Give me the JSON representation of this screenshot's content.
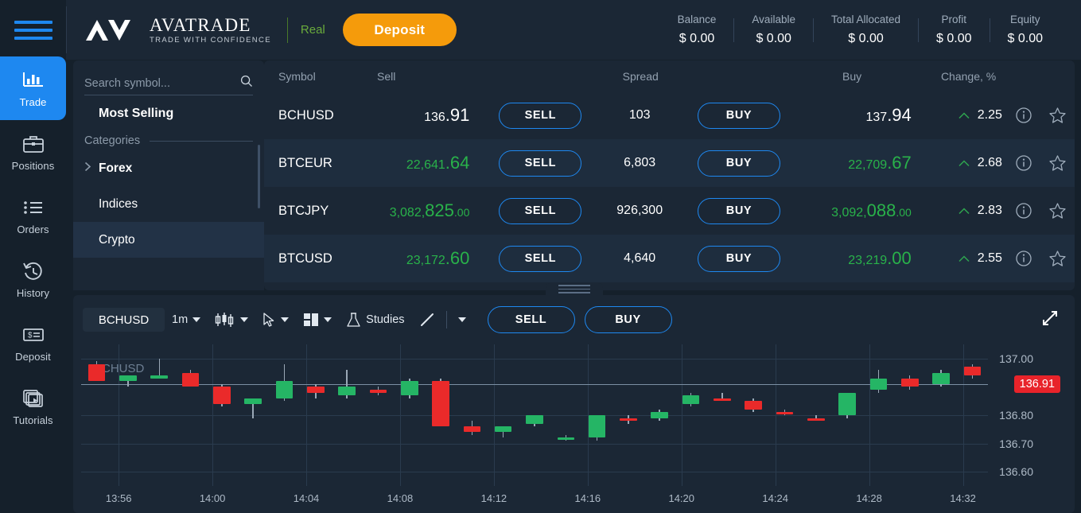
{
  "brand": {
    "logo_line1": "AVATRADE",
    "logo_line2": "TRADE WITH CONFIDENCE",
    "account_mode": "Real",
    "deposit_label": "Deposit",
    "accent_blue": "#1e88f0",
    "accent_orange": "#f59b0b",
    "accent_green": "#29b24a",
    "accent_red": "#e8232a"
  },
  "header_stats": [
    {
      "label": "Balance",
      "value": "$ 0.00"
    },
    {
      "label": "Available",
      "value": "$ 0.00"
    },
    {
      "label": "Total Allocated",
      "value": "$ 0.00"
    },
    {
      "label": "Profit",
      "value": "$ 0.00"
    },
    {
      "label": "Equity",
      "value": "$ 0.00"
    }
  ],
  "sidebar": {
    "items": [
      {
        "label": "Trade",
        "icon": "bar-chart-icon",
        "active": true
      },
      {
        "label": "Positions",
        "icon": "briefcase-icon",
        "active": false
      },
      {
        "label": "Orders",
        "icon": "list-icon",
        "active": false
      },
      {
        "label": "History",
        "icon": "clock-rewind-icon",
        "active": false
      },
      {
        "label": "Deposit",
        "icon": "cheque-icon",
        "active": false
      },
      {
        "label": "Tutorials",
        "icon": "video-stack-icon",
        "active": false
      }
    ]
  },
  "search_panel": {
    "placeholder": "Search symbol...",
    "value": "",
    "most_selling": "Most Selling",
    "categories_label": "Categories",
    "categories": [
      {
        "label": "Forex",
        "expandable": true,
        "selected": false
      },
      {
        "label": "Indices",
        "expandable": false,
        "selected": false
      },
      {
        "label": "Crypto",
        "expandable": false,
        "selected": true
      }
    ]
  },
  "quotes": {
    "columns": [
      "Symbol",
      "Sell",
      "Spread",
      "Buy",
      "Change, %"
    ],
    "sell_label": "SELL",
    "buy_label": "BUY",
    "rows": [
      {
        "symbol": "BCHUSD",
        "sell": {
          "pre": "136",
          "big": ".91",
          "post": "",
          "color": "white"
        },
        "spread": "103",
        "buy": {
          "pre": "137",
          "big": ".94",
          "post": "",
          "color": "white"
        },
        "change": "2.25",
        "direction": "up"
      },
      {
        "symbol": "BTCEUR",
        "sell": {
          "pre": "22,641",
          "big": ".64",
          "post": "",
          "color": "green"
        },
        "spread": "6,803",
        "buy": {
          "pre": "22,709",
          "big": ".67",
          "post": "",
          "color": "green"
        },
        "change": "2.68",
        "direction": "up"
      },
      {
        "symbol": "BTCJPY",
        "sell": {
          "pre": "3,082,",
          "big": "825",
          "post": ".00",
          "color": "green"
        },
        "spread": "926,300",
        "buy": {
          "pre": "3,092,",
          "big": "088",
          "post": ".00",
          "color": "green"
        },
        "change": "2.83",
        "direction": "up"
      },
      {
        "symbol": "BTCUSD",
        "sell": {
          "pre": "23,172",
          "big": ".60",
          "post": "",
          "color": "green"
        },
        "spread": "4,640",
        "buy": {
          "pre": "23,219",
          "big": ".00",
          "post": "",
          "color": "green"
        },
        "change": "2.55",
        "direction": "up"
      }
    ]
  },
  "chart_toolbar": {
    "symbol": "BCHUSD",
    "timeframe": "1m",
    "chart_type_icon": "candlestick-icon",
    "cursor_icon": "cursor-arrow-icon",
    "layout_icon": "layout-panels-icon",
    "studies_label": "Studies",
    "studies_icon": "flask-icon",
    "drawing_icon": "trend-line-icon",
    "sell_label": "SELL",
    "buy_label": "BUY",
    "expand_icon": "expand-arrows-icon"
  },
  "chart_data": {
    "type": "candlestick",
    "title": "BCHUSD",
    "watermark": "BCHUSD",
    "timeframe": "1m",
    "xlabel": "",
    "ylabel": "",
    "ylim": [
      136.55,
      137.05
    ],
    "y_ticks": [
      "137.00",
      "136.80",
      "136.70",
      "136.60"
    ],
    "y_tick_values": [
      137.0,
      136.8,
      136.7,
      136.6
    ],
    "x_ticks": [
      "13:56",
      "14:00",
      "14:04",
      "14:08",
      "14:12",
      "14:16",
      "14:20",
      "14:24",
      "14:28",
      "14:32"
    ],
    "current_price": "136.91",
    "current_price_value": 136.91,
    "grid": true,
    "up_color": "#25b565",
    "down_color": "#ea2a2a",
    "candles": [
      {
        "o": 136.98,
        "h": 136.99,
        "l": 136.92,
        "c": 136.92,
        "d": "down"
      },
      {
        "o": 136.92,
        "h": 136.94,
        "l": 136.9,
        "c": 136.94,
        "d": "up"
      },
      {
        "o": 136.93,
        "h": 137.0,
        "l": 136.93,
        "c": 136.94,
        "d": "up"
      },
      {
        "o": 136.95,
        "h": 136.96,
        "l": 136.9,
        "c": 136.9,
        "d": "down"
      },
      {
        "o": 136.9,
        "h": 136.91,
        "l": 136.83,
        "c": 136.84,
        "d": "down"
      },
      {
        "o": 136.84,
        "h": 136.85,
        "l": 136.79,
        "c": 136.86,
        "d": "up"
      },
      {
        "o": 136.86,
        "h": 136.98,
        "l": 136.85,
        "c": 136.92,
        "d": "up"
      },
      {
        "o": 136.9,
        "h": 136.91,
        "l": 136.86,
        "c": 136.88,
        "d": "down"
      },
      {
        "o": 136.87,
        "h": 136.96,
        "l": 136.86,
        "c": 136.9,
        "d": "up"
      },
      {
        "o": 136.89,
        "h": 136.9,
        "l": 136.87,
        "c": 136.88,
        "d": "down"
      },
      {
        "o": 136.87,
        "h": 136.93,
        "l": 136.86,
        "c": 136.92,
        "d": "up"
      },
      {
        "o": 136.92,
        "h": 136.93,
        "l": 136.76,
        "c": 136.76,
        "d": "down"
      },
      {
        "o": 136.76,
        "h": 136.78,
        "l": 136.73,
        "c": 136.74,
        "d": "down"
      },
      {
        "o": 136.74,
        "h": 136.76,
        "l": 136.72,
        "c": 136.76,
        "d": "up"
      },
      {
        "o": 136.77,
        "h": 136.8,
        "l": 136.76,
        "c": 136.8,
        "d": "up"
      },
      {
        "o": 136.72,
        "h": 136.73,
        "l": 136.71,
        "c": 136.72,
        "d": "up"
      },
      {
        "o": 136.72,
        "h": 136.8,
        "l": 136.71,
        "c": 136.8,
        "d": "up"
      },
      {
        "o": 136.79,
        "h": 136.8,
        "l": 136.77,
        "c": 136.78,
        "d": "down"
      },
      {
        "o": 136.79,
        "h": 136.82,
        "l": 136.78,
        "c": 136.81,
        "d": "up"
      },
      {
        "o": 136.84,
        "h": 136.88,
        "l": 136.83,
        "c": 136.87,
        "d": "up"
      },
      {
        "o": 136.86,
        "h": 136.88,
        "l": 136.85,
        "c": 136.85,
        "d": "down"
      },
      {
        "o": 136.85,
        "h": 136.86,
        "l": 136.81,
        "c": 136.82,
        "d": "down"
      },
      {
        "o": 136.81,
        "h": 136.82,
        "l": 136.8,
        "c": 136.81,
        "d": "down"
      },
      {
        "o": 136.79,
        "h": 136.8,
        "l": 136.78,
        "c": 136.79,
        "d": "down"
      },
      {
        "o": 136.8,
        "h": 136.88,
        "l": 136.79,
        "c": 136.88,
        "d": "up"
      },
      {
        "o": 136.89,
        "h": 136.96,
        "l": 136.88,
        "c": 136.93,
        "d": "up"
      },
      {
        "o": 136.93,
        "h": 136.94,
        "l": 136.89,
        "c": 136.9,
        "d": "down"
      },
      {
        "o": 136.91,
        "h": 136.96,
        "l": 136.9,
        "c": 136.95,
        "d": "up"
      },
      {
        "o": 136.97,
        "h": 136.98,
        "l": 136.93,
        "c": 136.94,
        "d": "down"
      }
    ]
  }
}
